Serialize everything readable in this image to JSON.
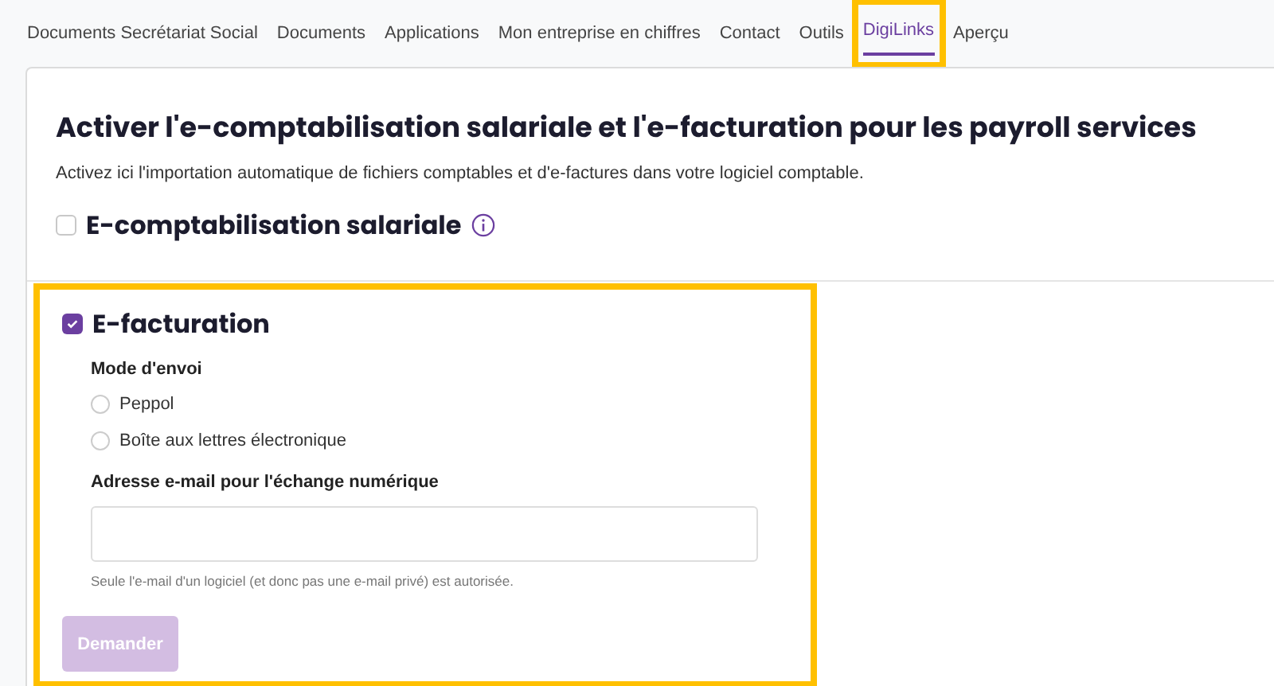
{
  "tabs": [
    {
      "label": "Documents Secrétariat Social",
      "selected": false,
      "highlighted": false
    },
    {
      "label": "Documents",
      "selected": false,
      "highlighted": false
    },
    {
      "label": "Applications",
      "selected": false,
      "highlighted": false
    },
    {
      "label": "Mon entreprise en chiffres",
      "selected": false,
      "highlighted": false
    },
    {
      "label": "Contact",
      "selected": false,
      "highlighted": false
    },
    {
      "label": "Outils",
      "selected": false,
      "highlighted": false
    },
    {
      "label": "DigiLinks",
      "selected": true,
      "highlighted": true
    },
    {
      "label": "Aperçu",
      "selected": false,
      "highlighted": false
    }
  ],
  "page": {
    "title": "Activer l'e-comptabilisation salariale et l'e-facturation pour les payroll services",
    "description": "Activez ici l'importation automatique de fichiers comptables et d'e-factures dans votre logiciel comptable."
  },
  "accounting": {
    "label": "E-comptabilisation salariale",
    "checked": false
  },
  "invoicing": {
    "label": "E-facturation",
    "checked": true,
    "highlighted": true,
    "mode_label": "Mode d'envoi",
    "modes": [
      {
        "label": "Peppol",
        "selected": false
      },
      {
        "label": "Boîte aux lettres électronique",
        "selected": false
      }
    ],
    "email_label": "Adresse e-mail pour l'échange numérique",
    "email_help": "Seule l'e-mail d'un logiciel (et donc pas une e-mail privé) est autorisée.",
    "submit": {
      "label": "Demander",
      "disabled": true
    }
  }
}
